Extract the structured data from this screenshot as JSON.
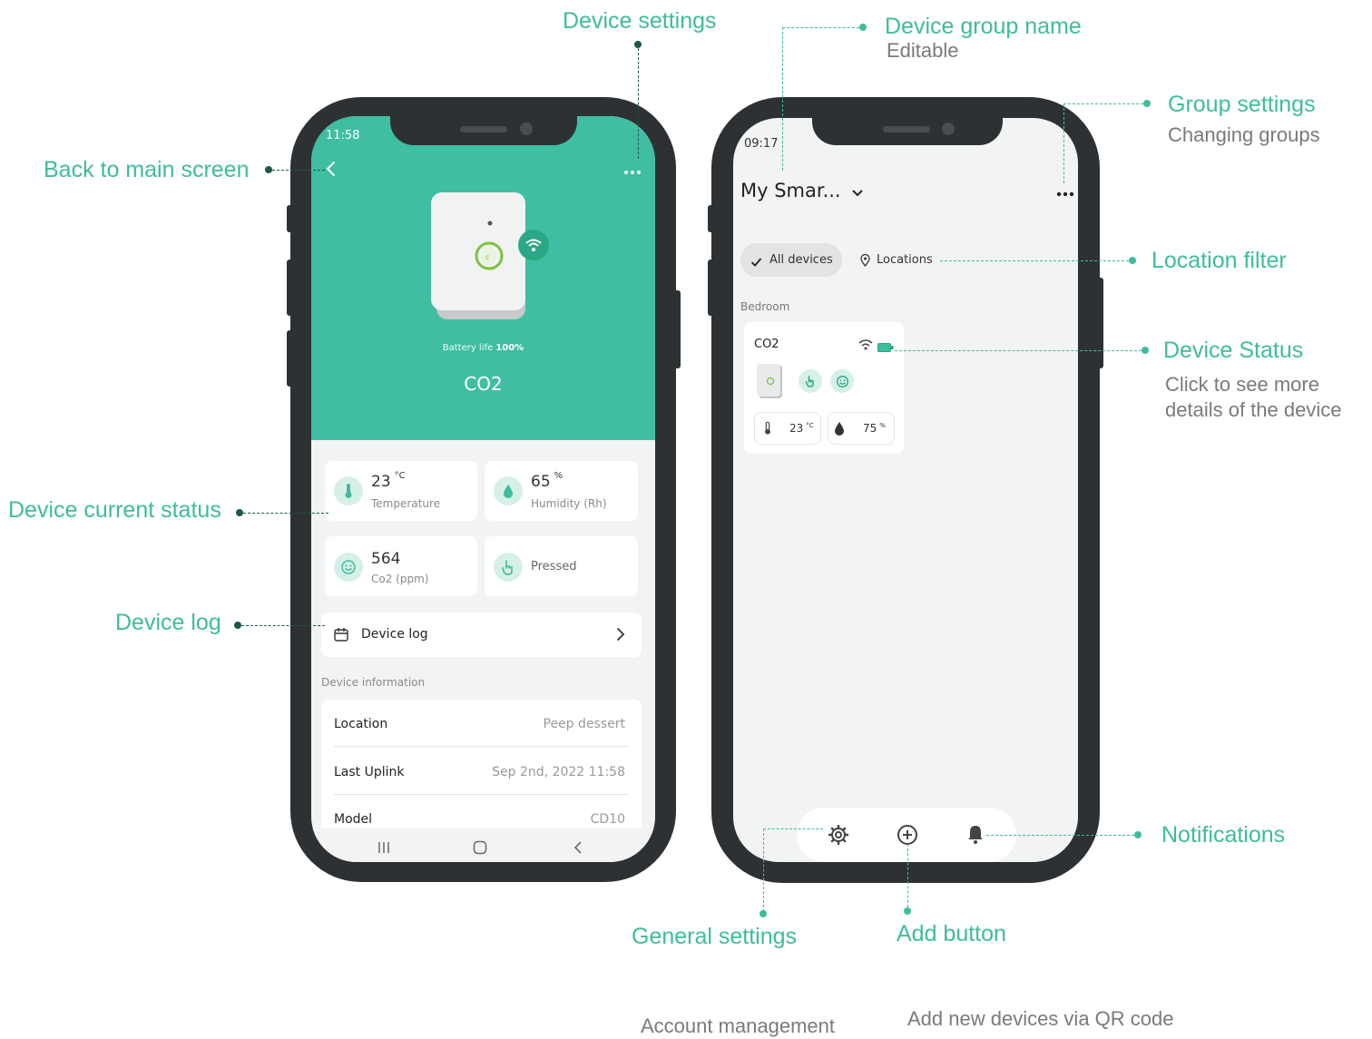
{
  "annotations": {
    "device_settings": "Device settings",
    "back_to_main": "Back to main screen",
    "device_current_status": "Device current status",
    "device_log": "Device log",
    "device_group_name": "Device group name",
    "device_group_name_sub": "Editable",
    "group_settings": "Group settings",
    "group_settings_sub": "Changing groups",
    "location_filter": "Location filter",
    "device_status": "Device Status",
    "device_status_sub1": "Click to see more",
    "device_status_sub2": "details of the device",
    "notifications": "Notifications",
    "general_settings": "General settings",
    "add_button": "Add button",
    "account_management": "Account management",
    "add_new_devices": "Add new devices via QR code"
  },
  "left_phone": {
    "time": "11:58",
    "battery_label": "Battery life",
    "battery_value": "100%",
    "device_name": "CO2",
    "temperature": {
      "value": "23",
      "unit": "°C",
      "label": "Temperature"
    },
    "humidity": {
      "value": "65",
      "unit": "%",
      "label": "Humidity (Rh)"
    },
    "co2": {
      "value": "564",
      "label": "Co2 (ppm)"
    },
    "button_state": "Pressed",
    "device_log_label": "Device log",
    "device_info_header": "Device information",
    "info_rows": [
      {
        "label": "Location",
        "value": "Peep dessert"
      },
      {
        "label": "Last Uplink",
        "value": "Sep 2nd, 2022 11:58"
      },
      {
        "label": "Model",
        "value": "CD10"
      }
    ]
  },
  "right_phone": {
    "time": "09:17",
    "group_name": "My Smar...",
    "filter_all": "All devices",
    "filter_locations": "Locations",
    "room": "Bedroom",
    "device_name": "CO2",
    "temp_value": "23",
    "temp_unit": "°C",
    "hum_value": "75",
    "hum_unit": "%"
  },
  "colors": {
    "accent": "#3dbd9c",
    "phone": "#2e3133",
    "screen_bg": "#f2f3f3"
  }
}
